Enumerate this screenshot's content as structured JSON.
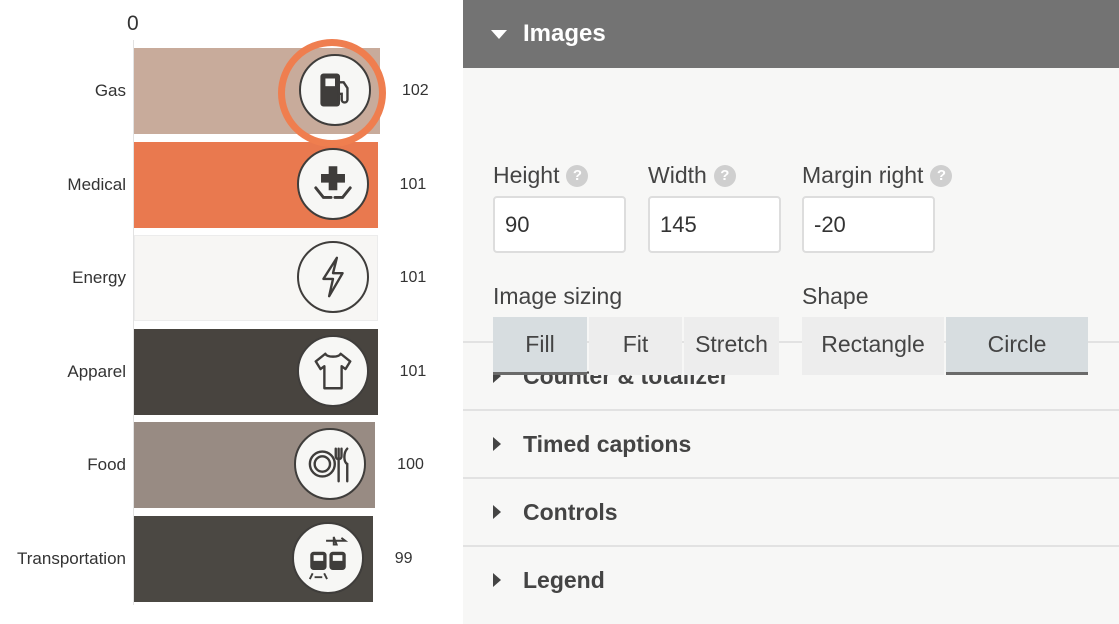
{
  "chart_data": {
    "type": "bar",
    "orientation": "horizontal",
    "axis_tick": "0",
    "categories": [
      "Gas",
      "Medical",
      "Energy",
      "Apparel",
      "Food",
      "Transportation"
    ],
    "values": [
      102,
      101,
      101,
      101,
      100,
      99
    ],
    "value_labels": [
      "102",
      "101",
      "101",
      "101",
      "100",
      "99"
    ],
    "colors": [
      "#c8ab9b",
      "#e9794f",
      "#f7f6f4",
      "#48443f",
      "#988b83",
      "#4b4843"
    ],
    "icons": [
      "gas-pump-icon",
      "medical-cross-hands-icon",
      "lightning-bolt-icon",
      "tshirt-icon",
      "plate-fork-knife-icon",
      "train-plane-bus-icon"
    ],
    "highlighted_category": "Gas",
    "highlight_color": "#ef7e4f"
  },
  "panel": {
    "images": {
      "title": "Images",
      "height_label": "Height",
      "height_value": "90",
      "width_label": "Width",
      "width_value": "145",
      "margin_label": "Margin right",
      "margin_value": "-20",
      "help_glyph": "?",
      "image_sizing_label": "Image sizing",
      "sizing_options": [
        "Fill",
        "Fit",
        "Stretch"
      ],
      "sizing_selected": "Fill",
      "shape_label": "Shape",
      "shape_options": [
        "Rectangle",
        "Circle"
      ],
      "shape_selected": "Circle"
    },
    "sections": [
      "Counter & totalizer",
      "Timed captions",
      "Controls",
      "Legend"
    ]
  },
  "colors": {
    "header_bg": "#737373",
    "panel_bg": "#f7f7f6",
    "active_segment": "#d7dde0"
  }
}
